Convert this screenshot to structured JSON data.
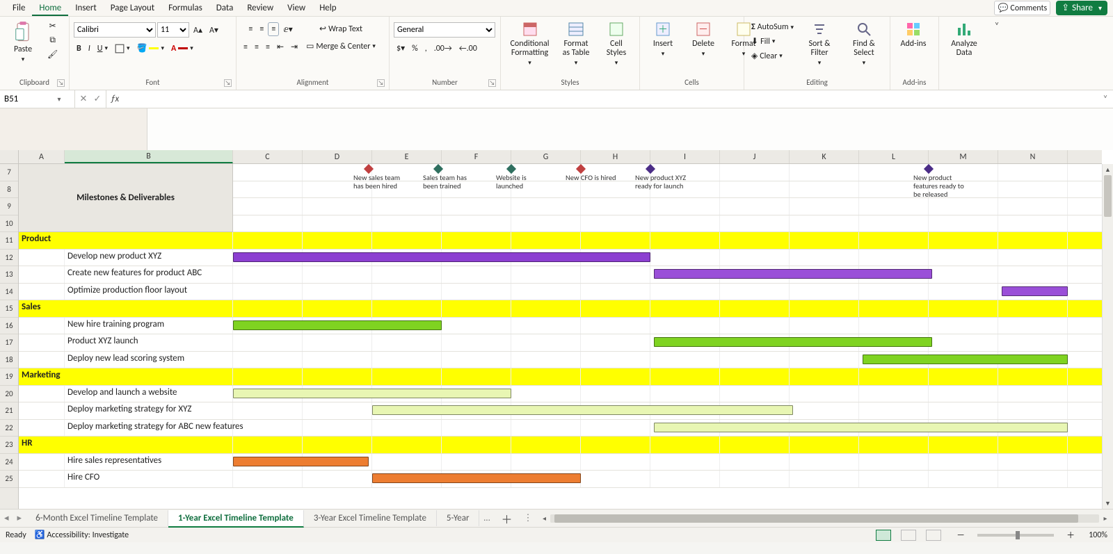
{
  "menu": {
    "items": [
      "File",
      "Home",
      "Insert",
      "Page Layout",
      "Formulas",
      "Data",
      "Review",
      "View",
      "Help"
    ],
    "active": 1
  },
  "topright": {
    "comments": "Comments",
    "share": "Share"
  },
  "ribbon": {
    "clipboard": {
      "paste": "Paste",
      "label": "Clipboard"
    },
    "font": {
      "family": "Calibri",
      "size": "11",
      "label": "Font"
    },
    "alignment": {
      "wrap": "Wrap Text",
      "merge": "Merge & Center",
      "label": "Alignment"
    },
    "number": {
      "format": "General",
      "label": "Number"
    },
    "styles": {
      "cond": "Conditional Formatting",
      "table": "Format as Table",
      "cell": "Cell Styles",
      "label": "Styles"
    },
    "cells": {
      "insert": "Insert",
      "delete": "Delete",
      "format": "Format",
      "label": "Cells"
    },
    "editing": {
      "sum": "AutoSum",
      "fill": "Fill",
      "clear": "Clear",
      "sort": "Sort & Filter",
      "find": "Find & Select",
      "label": "Editing"
    },
    "addins": {
      "addins": "Add-ins",
      "label": "Add-ins"
    },
    "analyze": {
      "btn": "Analyze Data"
    }
  },
  "namebox": "B51",
  "formula": "",
  "columns": [
    "A",
    "B",
    "C",
    "D",
    "E",
    "F",
    "G",
    "H",
    "I",
    "J",
    "K",
    "L",
    "M",
    "N"
  ],
  "rows_visible": [
    7,
    8,
    9,
    10,
    11,
    12,
    13,
    14,
    15,
    16,
    17,
    18,
    19,
    20,
    21,
    22,
    23,
    24,
    25
  ],
  "header_title": "Milestones & Deliverables",
  "milestones": [
    {
      "text": "New sales team has been hired",
      "col": 3.95,
      "cls": "dia-red"
    },
    {
      "text": "Sales team has been trained",
      "col": 4.95,
      "cls": "dia-teal"
    },
    {
      "text": "Website is launched",
      "col": 6.0,
      "cls": "dia-teal"
    },
    {
      "text": "New CFO is hired",
      "col": 7.0,
      "cls": "dia-red"
    },
    {
      "text": "New product XYZ ready for launch",
      "col": 8.0,
      "cls": "dia-purple"
    },
    {
      "text": "New  product features ready to be released",
      "col": 12.0,
      "cls": "dia-purple"
    }
  ],
  "sections": [
    {
      "row": 11,
      "name": "Product"
    },
    {
      "row": 15,
      "name": "Sales"
    },
    {
      "row": 19,
      "name": "Marketing"
    },
    {
      "row": 23,
      "name": "HR"
    }
  ],
  "tasks": [
    {
      "row": 12,
      "name": "Develop new product XYZ",
      "bar": {
        "start": 2.0,
        "end": 8.0,
        "cls": "purple"
      }
    },
    {
      "row": 13,
      "name": "Create new features for product ABC",
      "bar": {
        "start": 8.05,
        "end": 12.05,
        "cls": "pfill"
      }
    },
    {
      "row": 14,
      "name": "Optimize production floor layout",
      "bar": {
        "start": 13.05,
        "end": 14.95,
        "cls": "pfill"
      }
    },
    {
      "row": 16,
      "name": "New hire training program",
      "bar": {
        "start": 2.0,
        "end": 5.0,
        "cls": "green"
      }
    },
    {
      "row": 17,
      "name": "Product XYZ launch",
      "bar": {
        "start": 8.05,
        "end": 12.05,
        "cls": "green"
      }
    },
    {
      "row": 18,
      "name": "Deploy new lead scoring system",
      "bar": {
        "start": 11.05,
        "end": 14.95,
        "cls": "green"
      }
    },
    {
      "row": 20,
      "name": "Develop and launch a website",
      "bar": {
        "start": 2.0,
        "end": 6.0,
        "cls": "lgreen"
      }
    },
    {
      "row": 21,
      "name": "Deploy marketing strategy for XYZ",
      "bar": {
        "start": 4.0,
        "end": 10.05,
        "cls": "lgreen"
      }
    },
    {
      "row": 22,
      "name": "Deploy marketing strategy for ABC new features",
      "bar": {
        "start": 8.05,
        "end": 14.9,
        "cls": "lgreen"
      }
    },
    {
      "row": 24,
      "name": "Hire sales representatives",
      "bar": {
        "start": 2.0,
        "end": 3.95,
        "cls": "orange"
      }
    },
    {
      "row": 25,
      "name": "Hire CFO",
      "bar": {
        "start": 4.0,
        "end": 7.0,
        "cls": "orange"
      }
    }
  ],
  "sheets": {
    "tabs": [
      "6-Month Excel Timeline Template",
      "1-Year Excel Timeline Template",
      "3-Year Excel Timeline Template",
      "5-Year"
    ],
    "active": 1,
    "overflow": "…"
  },
  "status": {
    "ready": "Ready",
    "access": "Accessibility: Investigate",
    "zoom": "100%"
  },
  "chart_data": {
    "type": "gantt",
    "time_axis_columns": [
      "C",
      "D",
      "E",
      "F",
      "G",
      "H",
      "I",
      "J",
      "K",
      "L",
      "M",
      "N"
    ],
    "note": "columns map to 12 months of a 1-year plan; bar.start/end are 0-based column indices where 2=C",
    "groups": [
      {
        "name": "Product",
        "color": "#8c3fd1",
        "tasks": [
          {
            "name": "Develop new product XYZ",
            "start": 2,
            "end": 8
          },
          {
            "name": "Create new features for product ABC",
            "start": 8,
            "end": 12
          },
          {
            "name": "Optimize production floor layout",
            "start": 13,
            "end": 15
          }
        ]
      },
      {
        "name": "Sales",
        "color": "#7fd321",
        "tasks": [
          {
            "name": "New hire training program",
            "start": 2,
            "end": 5
          },
          {
            "name": "Product XYZ launch",
            "start": 8,
            "end": 12
          },
          {
            "name": "Deploy new lead scoring system",
            "start": 11,
            "end": 15
          }
        ]
      },
      {
        "name": "Marketing",
        "color": "#e8f6b3",
        "tasks": [
          {
            "name": "Develop and launch a website",
            "start": 2,
            "end": 6
          },
          {
            "name": "Deploy marketing strategy for XYZ",
            "start": 4,
            "end": 10
          },
          {
            "name": "Deploy marketing strategy for ABC new features",
            "start": 8,
            "end": 15
          }
        ]
      },
      {
        "name": "HR",
        "color": "#ed7d31",
        "tasks": [
          {
            "name": "Hire sales representatives",
            "start": 2,
            "end": 4
          },
          {
            "name": "Hire CFO",
            "start": 4,
            "end": 7
          }
        ]
      }
    ],
    "milestones": [
      {
        "name": "New sales team has been hired",
        "col": 4
      },
      {
        "name": "Sales team has been trained",
        "col": 5
      },
      {
        "name": "Website is launched",
        "col": 6
      },
      {
        "name": "New CFO is hired",
        "col": 7
      },
      {
        "name": "New product XYZ ready for launch",
        "col": 8
      },
      {
        "name": "New product features ready to be released",
        "col": 12
      }
    ]
  }
}
